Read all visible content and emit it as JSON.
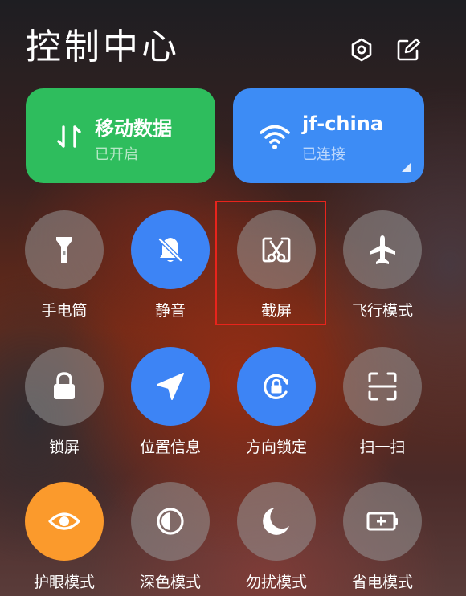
{
  "header": {
    "title": "控制中心",
    "settings_icon": "hexagon-settings-icon",
    "edit_icon": "edit-icon"
  },
  "cards": {
    "mobile_data": {
      "title": "移动数据",
      "status": "已开启",
      "icon": "data-arrows-icon",
      "color": "#2ebd5d"
    },
    "wifi": {
      "title": "jf-china",
      "status": "已连接",
      "icon": "wifi-icon",
      "color": "#3d8cf5"
    }
  },
  "tiles": {
    "flashlight": {
      "label": "手电筒",
      "icon": "flashlight-icon",
      "state": "off"
    },
    "mute": {
      "label": "静音",
      "icon": "bell-off-icon",
      "state": "on"
    },
    "screenshot": {
      "label": "截屏",
      "icon": "scissors-icon",
      "state": "off",
      "highlighted": true
    },
    "airplane": {
      "label": "飞行模式",
      "icon": "airplane-icon",
      "state": "off"
    },
    "lock_screen": {
      "label": "锁屏",
      "icon": "lock-icon",
      "state": "off"
    },
    "location": {
      "label": "位置信息",
      "icon": "location-arrow-icon",
      "state": "on"
    },
    "rotation_lock": {
      "label": "方向锁定",
      "icon": "rotation-lock-icon",
      "state": "on"
    },
    "scan": {
      "label": "扫一扫",
      "icon": "scan-icon",
      "state": "off"
    },
    "eye_care": {
      "label": "护眼模式",
      "icon": "eye-icon",
      "state": "on"
    },
    "dark_mode": {
      "label": "深色模式",
      "icon": "contrast-icon",
      "state": "off"
    },
    "do_not_disturb": {
      "label": "勿扰模式",
      "icon": "moon-icon",
      "state": "off"
    },
    "battery_saver": {
      "label": "省电模式",
      "icon": "battery-plus-icon",
      "state": "off"
    }
  },
  "colors": {
    "active_blue": "#3d84f5",
    "active_orange": "#fb9a2c",
    "highlight_red": "#e8241c"
  }
}
